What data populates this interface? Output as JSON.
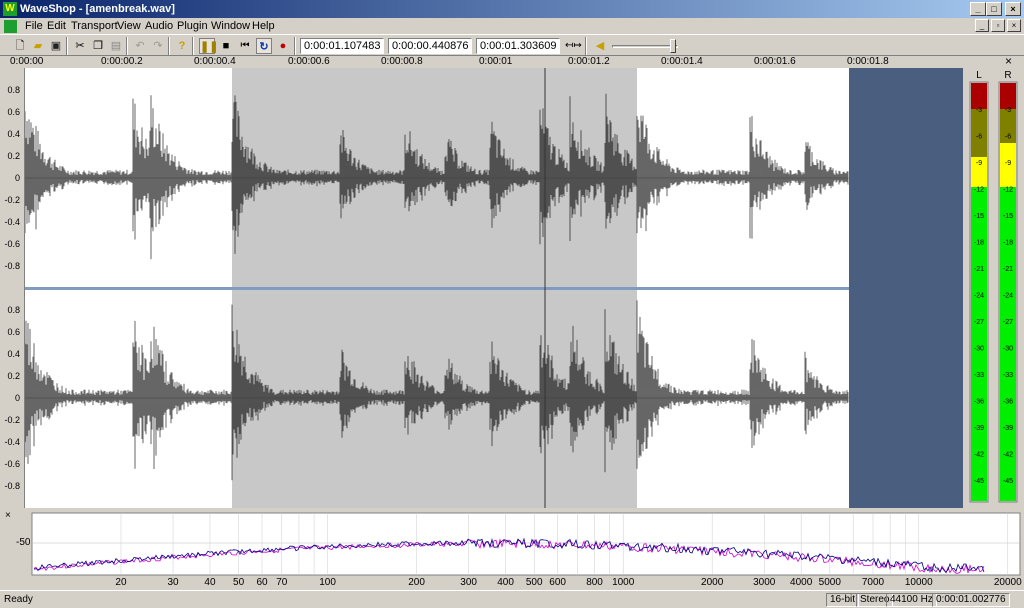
{
  "window": {
    "title": "WaveShop - [amenbreak.wav]",
    "app_icon": "W"
  },
  "menu": [
    "File",
    "Edit",
    "Transport",
    "View",
    "Audio",
    "Plugin",
    "Window",
    "Help"
  ],
  "toolbar": {
    "position": "0:00:01.107483",
    "length": "0:00:00.440876",
    "end": "0:00:01.303609",
    "icons": [
      "new-icon",
      "open-icon",
      "save-icon",
      "cut-icon",
      "copy-icon",
      "paste-icon",
      "undo-icon",
      "redo-icon",
      "help-icon",
      "pause-icon",
      "stop-icon",
      "rewind-icon",
      "loop-icon",
      "record-icon",
      "fit-icon",
      "volume-icon"
    ]
  },
  "ruler": [
    "0:00:00",
    "0:00:00.2",
    "0:00:00.4",
    "0:00:00.6",
    "0:00:00.8",
    "0:00:01",
    "0:00:01.2",
    "0:00:01.4",
    "0:00:01.6",
    "0:00:01.8"
  ],
  "amplitude_axis": [
    "0.8",
    "0.6",
    "0.4",
    "0.2",
    "0",
    "-0.2",
    "-0.4",
    "-0.6",
    "-0.8"
  ],
  "meters": {
    "left_label": "L",
    "right_label": "R",
    "scale": [
      "-3",
      "-6",
      "-9",
      "-12",
      "-15",
      "-18",
      "-21",
      "-24",
      "-27",
      "-30",
      "-33",
      "-36",
      "-39",
      "-42",
      "-45"
    ],
    "colors": {
      "red": "#aa0000",
      "olive": "#808000",
      "yellow": "#ffff00",
      "green": "#00ee00"
    }
  },
  "spectrum": {
    "db_label": "-50",
    "freq_labels": [
      "20",
      "30",
      "40",
      "50",
      "60",
      "70",
      "100",
      "200",
      "300",
      "400",
      "500",
      "600",
      "800",
      "1000",
      "2000",
      "3000",
      "4000",
      "5000",
      "7000",
      "10000",
      "20000"
    ]
  },
  "status": {
    "ready": "Ready",
    "bits": "16-bit",
    "channels": "Stereo",
    "rate": "44100 Hz",
    "time": "0:00:01.002776"
  },
  "colors": {
    "selection": "#c8c8c8",
    "beyond": "#4a5f7f",
    "wave": "#000000",
    "separator": "#7f9bbf"
  }
}
